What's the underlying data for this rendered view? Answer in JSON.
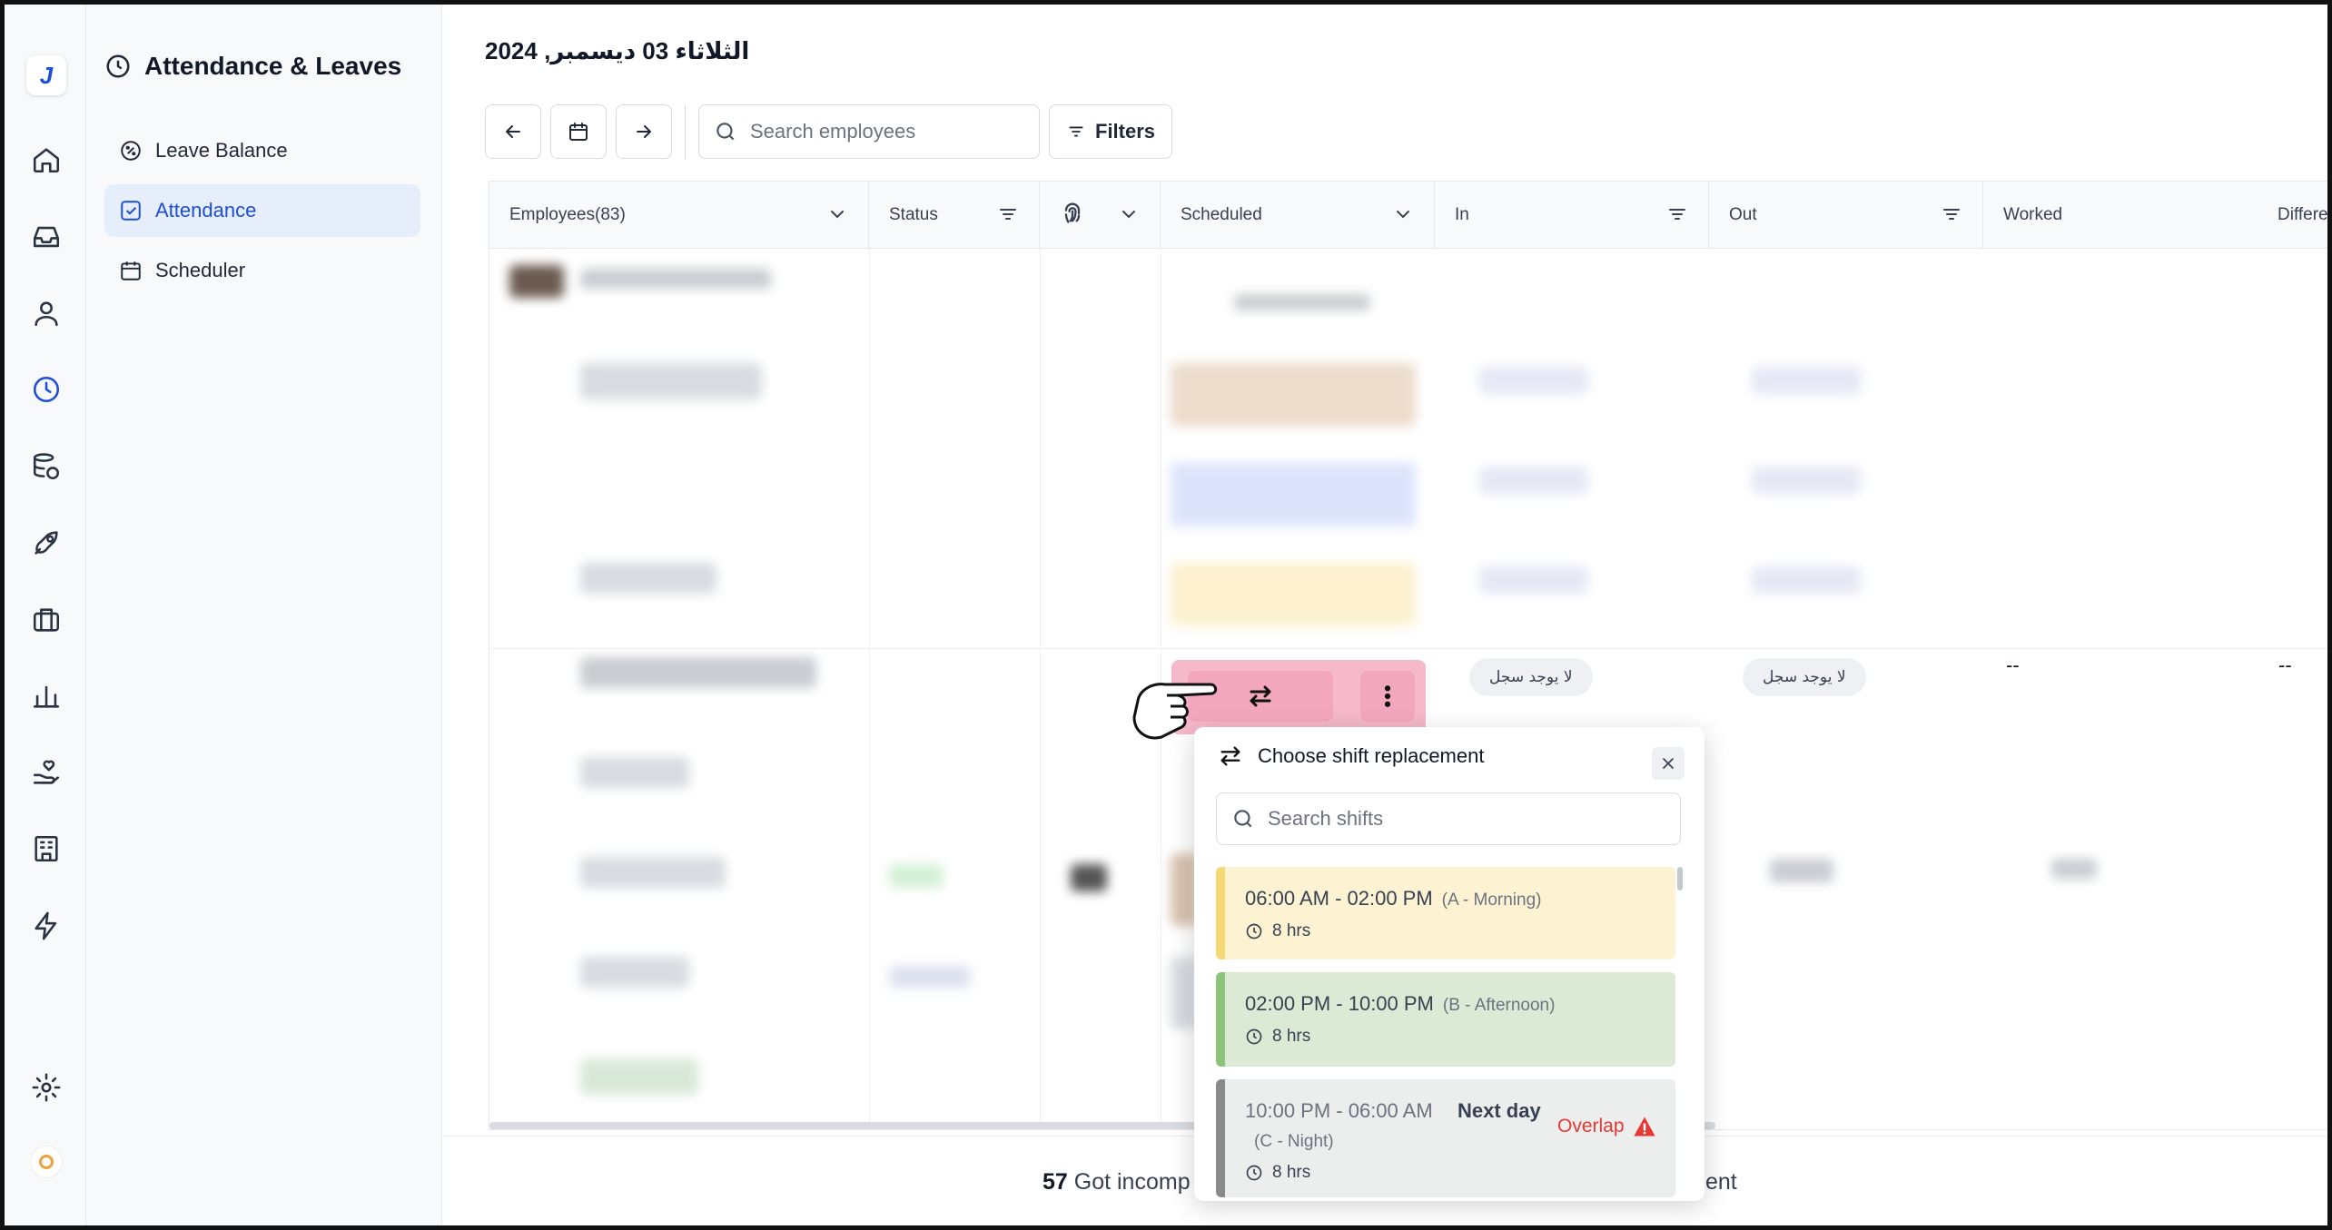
{
  "app": {
    "logo_letter": "J"
  },
  "rail": {
    "icons": [
      "home-icon",
      "inbox-icon",
      "user-icon",
      "clock-icon",
      "database-icon",
      "rocket-icon",
      "briefcase-icon",
      "bar-chart-icon",
      "hand-heart-icon",
      "building-icon",
      "lightning-icon",
      "settings-icon"
    ],
    "active": "clock-icon"
  },
  "subnav": {
    "title": "Attendance & Leaves",
    "items": [
      {
        "label": "Leave Balance",
        "icon": "percent-badge-icon",
        "active": false
      },
      {
        "label": "Attendance",
        "icon": "check-square-icon",
        "active": true
      },
      {
        "label": "Scheduler",
        "icon": "calendar-icon",
        "active": false
      }
    ]
  },
  "header": {
    "date": "الثلاثاء 03 ديسمبر, 2024"
  },
  "toolbar": {
    "search_placeholder": "Search employees",
    "filters_label": "Filters"
  },
  "table": {
    "columns": [
      "Employees(83)",
      "Status",
      "",
      "Scheduled",
      "In",
      "Out",
      "Worked",
      "Differe"
    ],
    "visible_row": {
      "in": "لا يوجد سجل",
      "out": "لا يوجد سجل",
      "worked": "--",
      "difference": "--"
    }
  },
  "popover": {
    "title": "Choose shift replacement",
    "search_placeholder": "Search shifts",
    "options": [
      {
        "time": "06:00 AM - 02:00 PM",
        "code": "(A - Morning)",
        "hours": "8 hrs",
        "color": "#f6d874"
      },
      {
        "time": "02:00 PM - 10:00 PM",
        "code": "(B - Afternoon)",
        "hours": "8 hrs",
        "color": "#8cc47a"
      },
      {
        "time": "10:00 PM - 06:00 AM",
        "code": "(C - Night)",
        "next_day": "Next day",
        "overlap": "Overlap",
        "hours": "8 hrs",
        "color": "#8a8a8a"
      }
    ]
  },
  "footer": {
    "count": "57",
    "text": "Got incomp",
    "tail": "ent"
  },
  "colors": {
    "accent": "#1d4ed8",
    "pink_shift": "#f6b8cb",
    "overlap": "#e53935"
  }
}
